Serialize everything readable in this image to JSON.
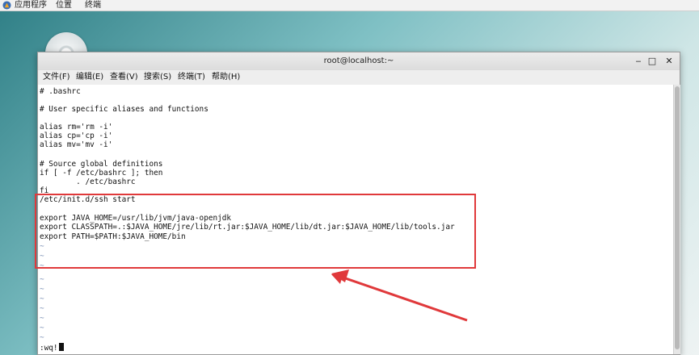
{
  "topbar": {
    "applications": "应用程序",
    "places": "位置",
    "terminal": "终端"
  },
  "window": {
    "title": "root@localhost:~",
    "minimize_glyph": "‒",
    "maximize_glyph": "□",
    "close_glyph": "✕"
  },
  "menubar": {
    "items": [
      "文件(F)",
      "编辑(E)",
      "查看(V)",
      "搜索(S)",
      "终端(T)",
      "帮助(H)"
    ]
  },
  "editor": {
    "lines": [
      "# .bashrc",
      "",
      "# User specific aliases and functions",
      "",
      "alias rm='rm -i'",
      "alias cp='cp -i'",
      "alias mv='mv -i'",
      "",
      "# Source global definitions",
      "if [ -f /etc/bashrc ]; then",
      "        . /etc/bashrc",
      "fi",
      "/etc/init.d/ssh start",
      "",
      "export JAVA_HOME=/usr/lib/jvm/java-openjdk",
      "export CLASSPATH=.:$JAVA_HOME/jre/lib/rt.jar:$JAVA_HOME/lib/dt.jar:$JAVA_HOME/lib/tools.jar",
      "export PATH=$PATH:$JAVA_HOME/bin"
    ],
    "tilde_lines": [
      "~",
      "~",
      "~",
      "~",
      "~",
      "~",
      "~",
      "~",
      "~",
      "~"
    ],
    "command": ":wq!"
  },
  "colors": {
    "highlight_box": "#e0393b",
    "arrow": "#e0393b"
  }
}
